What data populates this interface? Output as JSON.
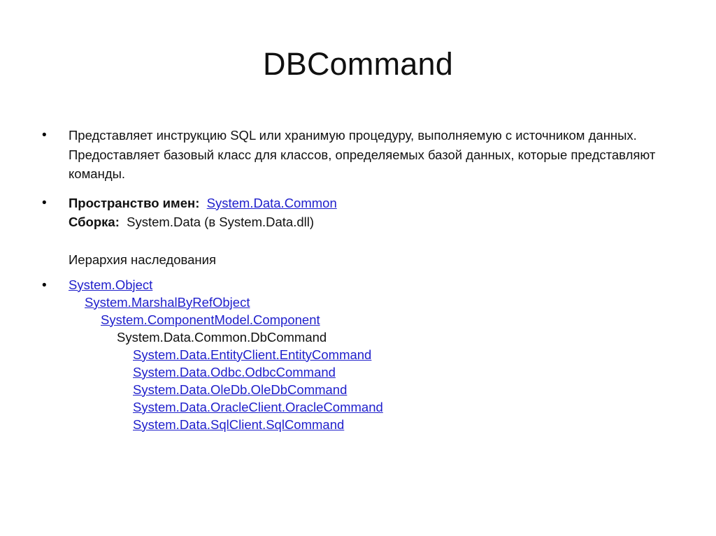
{
  "slide": {
    "title": "DBCommand",
    "bullet_glyph": "•",
    "link_color": "#2020cc",
    "text_color": "#111111"
  },
  "content": {
    "description": "Представляет инструкцию SQL или хранимую процедуру, выполняемую с источником данных. Предоставляет базовый класс для классов, определяемых базой данных, которые представляют команды.",
    "namespace_label": "Пространство имен:",
    "namespace_value": "System.Data.Common",
    "assembly_label": "Сборка:",
    "assembly_value": "System.Data (в System.Data.dll)",
    "hierarchy_heading": "Иерархия наследования",
    "hierarchy": [
      {
        "text": "System.Object",
        "indent": 0,
        "link": true
      },
      {
        "text": "System.MarshalByRefObject",
        "indent": 1,
        "link": true
      },
      {
        "text": "System.ComponentModel.Component",
        "indent": 2,
        "link": true
      },
      {
        "text": "System.Data.Common.DbCommand",
        "indent": 3,
        "link": false
      },
      {
        "text": "System.Data.EntityClient.EntityCommand",
        "indent": 4,
        "link": true
      },
      {
        "text": "System.Data.Odbc.OdbcCommand",
        "indent": 4,
        "link": true
      },
      {
        "text": "System.Data.OleDb.OleDbCommand",
        "indent": 4,
        "link": true
      },
      {
        "text": "System.Data.OracleClient.OracleCommand",
        "indent": 4,
        "link": true
      },
      {
        "text": "System.Data.SqlClient.SqlCommand",
        "indent": 4,
        "link": true
      }
    ]
  }
}
